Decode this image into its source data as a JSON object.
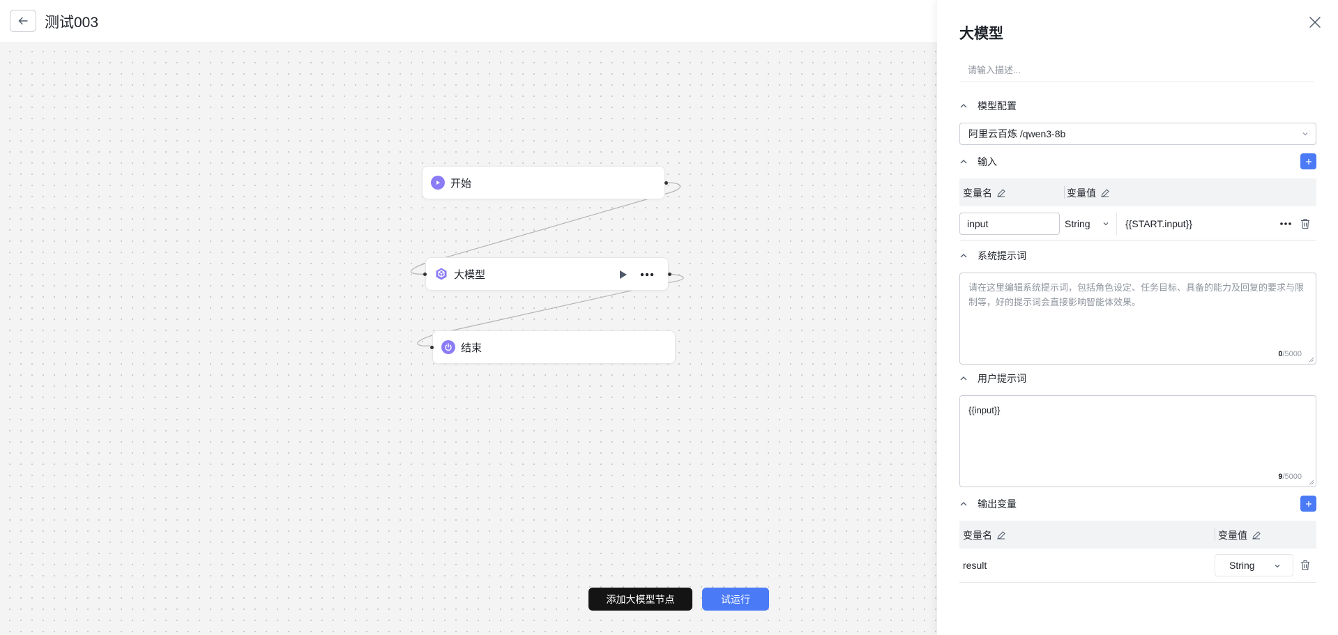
{
  "header": {
    "title": "测试003",
    "back_icon": "arrow-left-icon"
  },
  "canvas": {
    "nodes": {
      "start": {
        "label": "开始",
        "icon": "play-circle-icon"
      },
      "llm": {
        "label": "大模型",
        "icon": "cube-icon"
      },
      "end": {
        "label": "结束",
        "icon": "power-icon"
      }
    },
    "buttons": {
      "add_llm_node": "添加大模型节点",
      "try_run": "试运行"
    }
  },
  "panel": {
    "title": "大模型",
    "description_placeholder": "请输入描述...",
    "model_config": {
      "heading": "模型配置",
      "selected_model": "阿里云百炼 /qwen3-8b"
    },
    "input": {
      "heading": "输入",
      "col_name": "变量名",
      "col_value": "变量值",
      "rows": [
        {
          "name": "input",
          "type": "String",
          "value": "{{START.input}}"
        }
      ]
    },
    "system_prompt": {
      "heading": "系统提示词",
      "placeholder": "请在这里编辑系统提示词，包括角色设定、任务目标、具备的能力及回复的要求与限制等，好的提示词会直接影响智能体效果。",
      "count": "0",
      "max": "/5000"
    },
    "user_prompt": {
      "heading": "用户提示词",
      "value": "{{input}}",
      "count": "9",
      "max": "/5000"
    },
    "output": {
      "heading": "输出变量",
      "col_name": "变量名",
      "col_value": "变量值",
      "rows": [
        {
          "name": "result",
          "type": "String"
        }
      ]
    }
  },
  "colors": {
    "accent": "#4a7af5",
    "node_icon": "#8b7cf6",
    "dark_button": "#141414"
  }
}
